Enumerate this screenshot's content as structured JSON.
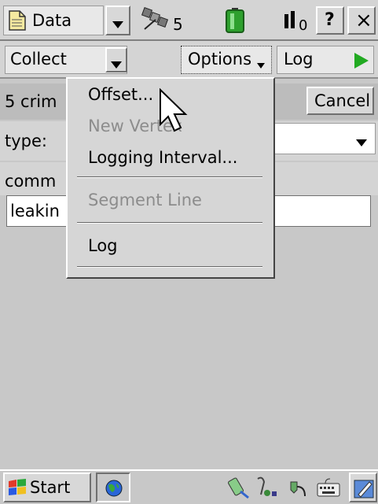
{
  "topbar": {
    "app_menu_label": "Data",
    "satellite_count": "5",
    "signal_value": "0",
    "help_label": "?",
    "close_label": "×"
  },
  "toolbar": {
    "collect_label": "Collect",
    "options_label": "Options",
    "log_label": "Log"
  },
  "form": {
    "header_text": "5 crim",
    "cancel_label": "Cancel",
    "type_label": "type:",
    "comment_label": "comm",
    "comment_value": "leakin"
  },
  "options_menu": {
    "items": [
      {
        "label": "Offset...",
        "enabled": true
      },
      {
        "label": "New Vertex",
        "enabled": false
      },
      {
        "label": "Logging Interval...",
        "enabled": true
      },
      {
        "label": "Segment Line",
        "enabled": false
      },
      {
        "label": "Log",
        "enabled": true
      }
    ]
  },
  "taskbar": {
    "start_label": "Start"
  },
  "colors": {
    "log_play": "#22aa22",
    "battery": "#2ea02e",
    "disabled_text": "#8c8c8c"
  }
}
